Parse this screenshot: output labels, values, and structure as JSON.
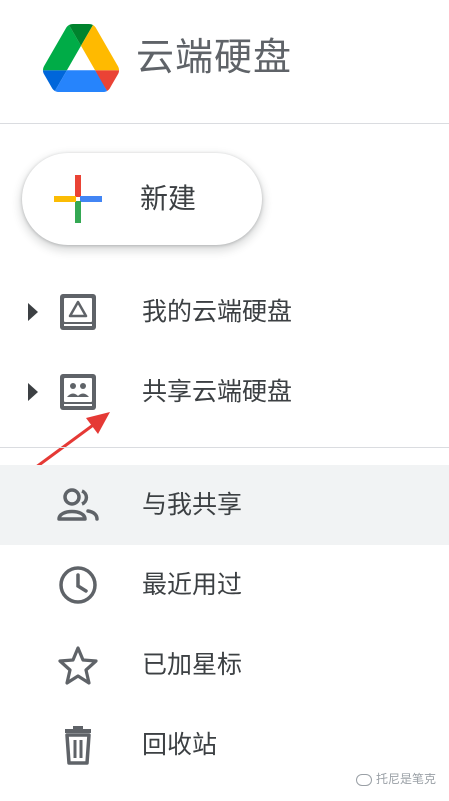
{
  "app": {
    "title": "云端硬盘"
  },
  "new_button": {
    "label": "新建"
  },
  "nav": {
    "my_drive": "我的云端硬盘",
    "shared_drives": "共享云端硬盘",
    "shared_with_me": "与我共享",
    "recent": "最近用过",
    "starred": "已加星标",
    "trash": "回收站"
  },
  "watermark": "托尼是笔克",
  "colors": {
    "logo_green": "#1fa463",
    "logo_yellow": "#ffd04b",
    "logo_blue": "#4688f4",
    "plus_red": "#ea4335",
    "plus_blue": "#4285f4",
    "plus_green": "#34a853",
    "plus_yellow": "#fbbc04",
    "active_bg": "#f1f3f4",
    "arrow": "#e53935",
    "icon": "#5f6368"
  }
}
